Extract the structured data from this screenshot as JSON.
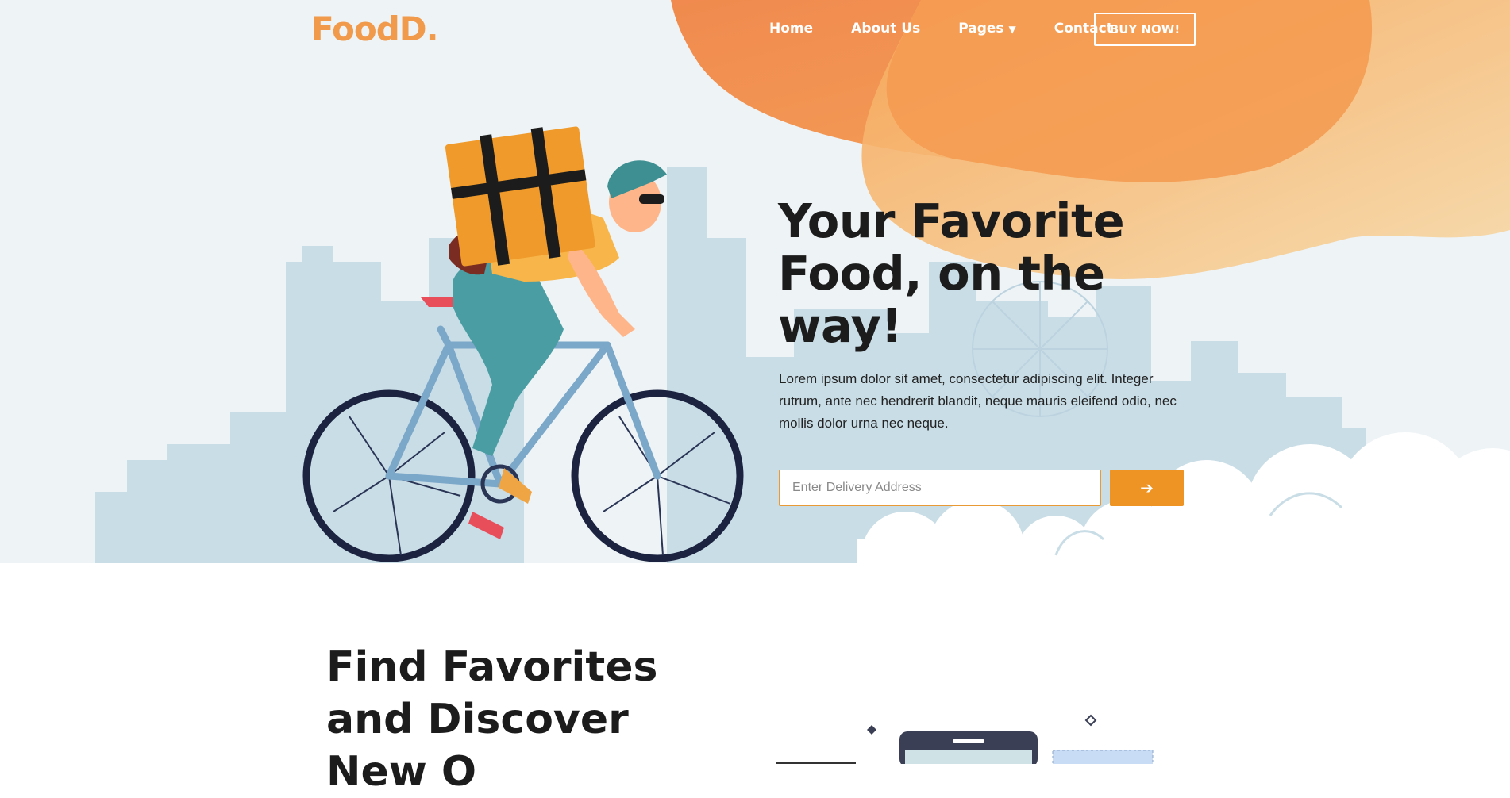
{
  "header": {
    "logo": "FoodD.",
    "nav": {
      "home": "Home",
      "about": "About Us",
      "pages": "Pages",
      "contact": "Contact"
    },
    "buy_label": "BUY NOW!"
  },
  "hero": {
    "title": "Your Favorite Food, on the way!",
    "description": "Lorem ipsum dolor sit amet, consectetur adipiscing elit. Integer rutrum, ante nec hendrerit blandit, neque mauris eleifend odio, nec mollis dolor urna nec neque.",
    "address_placeholder": "Enter Delivery Address",
    "go_label": "➔"
  },
  "section2": {
    "title": "Find Favorites and Discover New O"
  },
  "colors": {
    "brand_orange": "#f19a4c",
    "button_orange": "#ee9425",
    "hero_bg": "#eef3f5",
    "text_dark": "#1c1c1c"
  },
  "icons": {
    "nav_dropdown": "chevron-down-icon",
    "submit": "arrow-right-icon"
  }
}
